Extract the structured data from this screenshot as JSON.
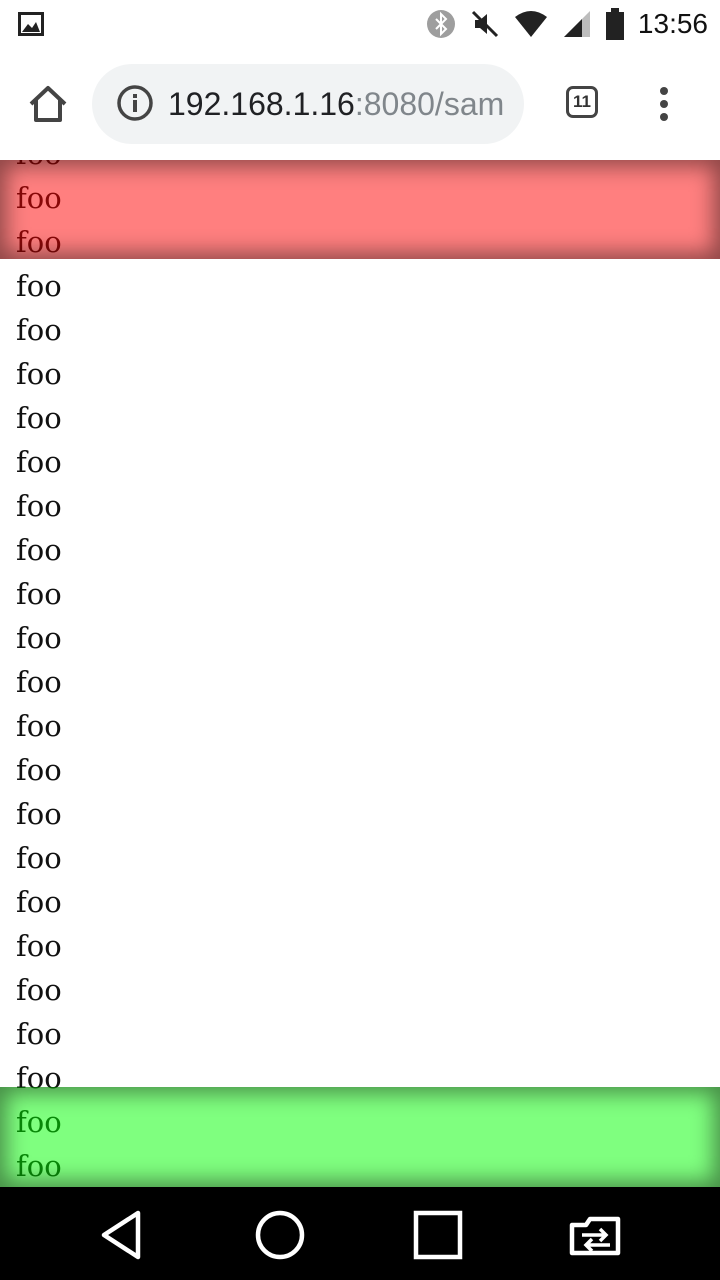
{
  "status_bar": {
    "time": "13:56",
    "icons": [
      "image-notification-icon",
      "bluetooth-icon",
      "mute-icon",
      "wifi-icon",
      "signal-icon",
      "battery-icon"
    ]
  },
  "browser": {
    "url_host": "192.168.1.16",
    "url_rest": ":8080/sam",
    "tab_count": "11",
    "icons": [
      "home-icon",
      "info-icon",
      "tab-switcher-icon",
      "overflow-menu-icon"
    ]
  },
  "page": {
    "items": [
      "foo",
      "foo",
      "foo",
      "foo",
      "foo",
      "foo",
      "foo",
      "foo",
      "foo",
      "foo",
      "foo",
      "foo",
      "foo",
      "foo",
      "foo",
      "foo",
      "foo",
      "foo",
      "foo",
      "foo",
      "foo",
      "foo",
      "foo",
      "foo"
    ],
    "top_band_color": "#ff0000",
    "bottom_band_color": "#00ff00"
  },
  "nav_bar": {
    "icons": [
      "back-icon",
      "home-circle-icon",
      "recents-icon",
      "rotate-switch-icon"
    ]
  }
}
